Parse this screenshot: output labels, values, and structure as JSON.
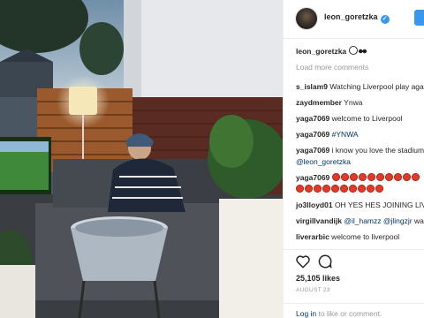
{
  "post": {
    "username": "leon_goretzka",
    "caption_user": "leon_goretzka",
    "load_more": "Load more comments",
    "likes": "25,105 likes",
    "date": "AUGUST 23",
    "login_link": "Log in",
    "login_rest": " to like or comment."
  },
  "comments": [
    {
      "user": "s_islam9",
      "text": " Watching Liverpool play agai hoffenheim"
    },
    {
      "user": "zaydmember",
      "text": " Ynwa"
    },
    {
      "user": "yaga7069",
      "text": " welcome to Liverpool"
    },
    {
      "user": "yaga7069",
      "text": " #YNWA"
    },
    {
      "user": "yaga7069",
      "text": " i know you love the stadium",
      "mention": "@leon_goretzka"
    },
    {
      "user": "yaga7069",
      "emoji_count": 20
    },
    {
      "user": "jo3lloyd01",
      "text": " OH YES HES JOINING LIVERPOOL MY HERO"
    },
    {
      "user": "virgillvandijk",
      "mention1": "@il_hamzz",
      "mention2": "@jlingzjr",
      "text": " wat lfc hoffenheim"
    },
    {
      "user": "liverarbic",
      "text": " welcome to liverpool"
    }
  ],
  "icons": [
    "heart-icon",
    "comment-icon",
    "verified-icon",
    "soccer-ball-emoji",
    "eyes-emoji",
    "red-circle-emoji"
  ]
}
